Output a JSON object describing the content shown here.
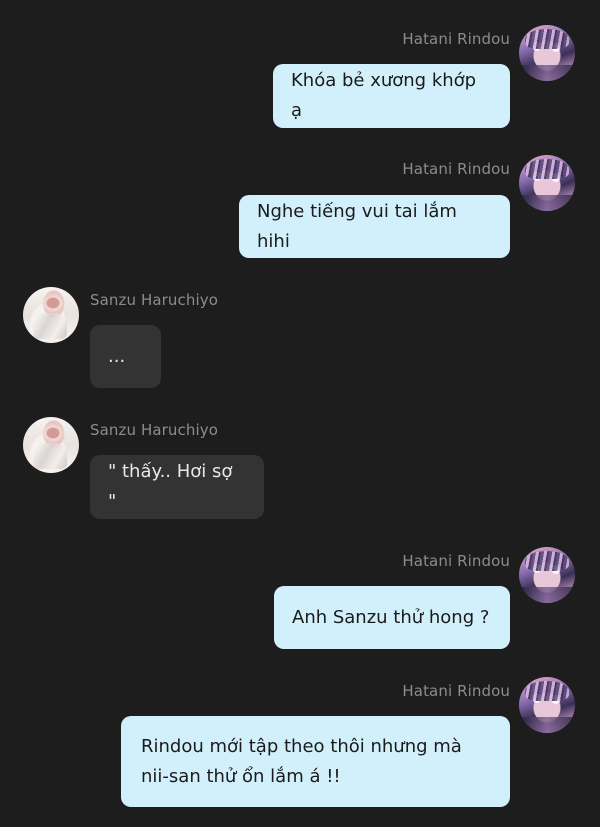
{
  "messages": [
    {
      "sender": "Hatani Rindou",
      "side": "right",
      "text": "Khóa bẻ xương khớp ạ"
    },
    {
      "sender": "Hatani Rindou",
      "side": "right",
      "text": "Nghe tiếng vui tai lắm hihi"
    },
    {
      "sender": "Sanzu Haruchiyo",
      "side": "left",
      "text": "..."
    },
    {
      "sender": "Sanzu Haruchiyo",
      "side": "left",
      "text": "\" thấy.. Hơi sợ \""
    },
    {
      "sender": "Hatani Rindou",
      "side": "right",
      "text": "Anh Sanzu thử hong ?"
    },
    {
      "sender": "Hatani Rindou",
      "side": "right",
      "text": "Rindou mới tập theo thôi nhưng mà nii-san thử ổn lắm á !!"
    }
  ],
  "colors": {
    "background": "#1d1d1d",
    "outgoing_bubble": "#d1f0fc",
    "incoming_bubble": "#333333",
    "name_text": "#8c8c8c"
  }
}
